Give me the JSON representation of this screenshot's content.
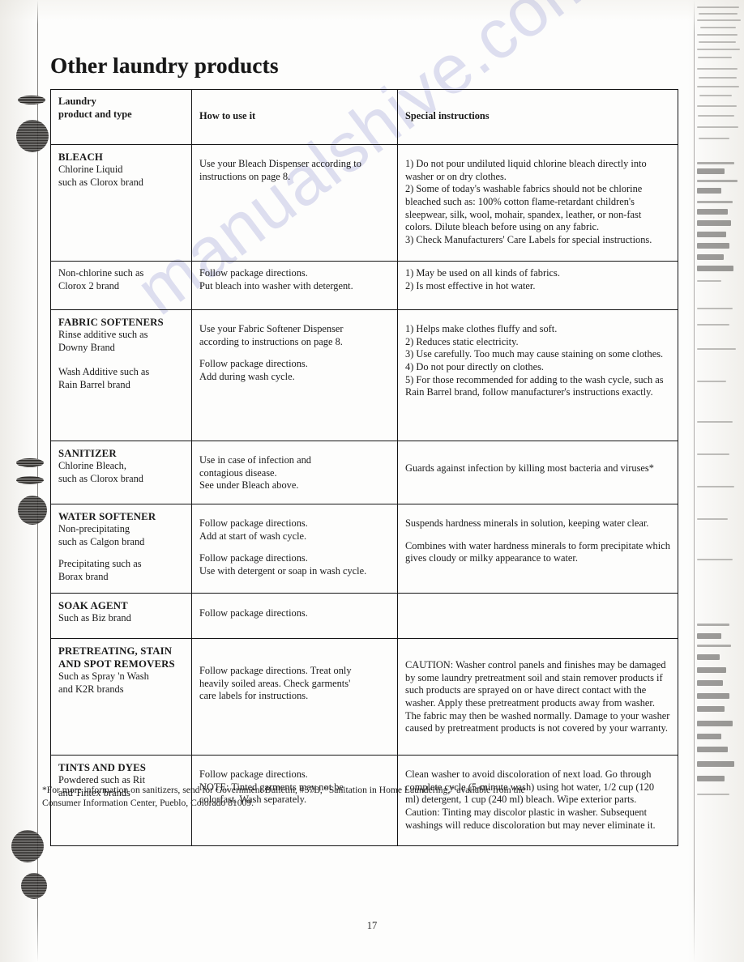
{
  "page": {
    "title": "Other laundry products",
    "number": "17",
    "watermark": "manualshive.com"
  },
  "table": {
    "headers": {
      "product": "Laundry\nproduct and type",
      "product_line1": "Laundry",
      "product_line2": "product and type",
      "how_to_use": "How to use it",
      "special": "Special instructions"
    },
    "rows": [
      {
        "id": "bleach",
        "product_title": "BLEACH",
        "product_sub": [
          "Chlorine Liquid",
          "such as Clorox brand"
        ],
        "how_to_use": [
          "Use your Bleach Dispenser according to",
          "instructions on page 8."
        ],
        "special": [
          "1) Do not pour undiluted liquid chlorine bleach directly into washer or on dry clothes.",
          "2) Some of today's washable fabrics should not be chlorine bleached such as: 100% cotton flame-retardant children's sleepwear, silk, wool, mohair, spandex, leather, or non-fast colors. Dilute bleach before using on any fabric.",
          "3) Check Manufacturers' Care Labels for special instructions."
        ]
      },
      {
        "id": "bleach-nonchlorine",
        "product_title": "",
        "product_sub": [
          "Non-chlorine such as",
          "Clorox 2 brand"
        ],
        "how_to_use": [
          "Follow package directions.",
          "Put bleach into washer with detergent."
        ],
        "special": [
          "1) May be used on all kinds of fabrics.",
          "2) Is most effective in hot water."
        ]
      },
      {
        "id": "fabric-softeners",
        "product_title": "FABRIC SOFTENERS",
        "product_sub": [
          "Rinse additive such as",
          "Downy Brand"
        ],
        "product_sub2": [
          "Wash Additive such as",
          "Rain Barrel brand"
        ],
        "how_to_use": [
          "Use your Fabric Softener Dispenser",
          "according to instructions on page 8."
        ],
        "how_to_use2": [
          "Follow package directions.",
          "Add during wash cycle."
        ],
        "special": [
          "1) Helps make clothes fluffy and soft.",
          "2) Reduces static electricity.",
          "3) Use carefully. Too much may cause staining on some clothes.",
          "4) Do not pour directly on clothes.",
          "5) For those recommended for adding to the wash cycle, such as Rain Barrel brand, follow manufacturer's instructions exactly."
        ]
      },
      {
        "id": "sanitizer",
        "product_title": "SANITIZER",
        "product_sub": [
          "Chlorine Bleach,",
          "such as Clorox brand"
        ],
        "how_to_use": [
          "Use in case of infection and",
          "contagious disease.",
          "See under Bleach above."
        ],
        "special_plain": "Guards against infection by killing most bacteria and viruses*"
      },
      {
        "id": "water-softener",
        "product_title": "WATER SOFTENER",
        "product_sub": [
          "Non-precipitating",
          "such as Calgon brand"
        ],
        "product_sub2": [
          "Precipitating such as",
          "Borax brand"
        ],
        "how_to_use": [
          "Follow package directions.",
          "Add at start of wash cycle."
        ],
        "how_to_use2": [
          "Follow package directions.",
          "Use with detergent or soap in wash cycle."
        ],
        "special_plain": "Suspends hardness minerals in solution, keeping water clear.",
        "special_plain2": "Combines with water hardness minerals to form precipitate which gives cloudy or milky appearance to water."
      },
      {
        "id": "soak-agent",
        "product_title": "SOAK AGENT",
        "product_sub": [
          "Such as Biz brand"
        ],
        "how_to_use": [
          "Follow package directions."
        ],
        "special_plain": ""
      },
      {
        "id": "pretreating",
        "product_title_line1": "PRETREATING, STAIN",
        "product_title_line2": "AND SPOT REMOVERS",
        "product_sub": [
          "Such as Spray 'n Wash",
          "and K2R brands"
        ],
        "how_to_use": [
          "Follow package directions. Treat only",
          "heavily soiled areas. Check garments'",
          "care labels for instructions."
        ],
        "special_plain": "CAUTION: Washer control panels and finishes may be damaged by some laundry pretreatment soil and stain remover products if such products are sprayed on or have direct contact with the washer. Apply these pretreatment products away from washer. The fabric may then be washed normally. Damage to your washer caused by pretreatment products is not covered by your warranty."
      },
      {
        "id": "tints-and-dyes",
        "product_title": "TINTS AND DYES",
        "product_sub": [
          "Powdered such as Rit",
          "and Tintex brands"
        ],
        "how_to_use": [
          "Follow package directions.",
          "NOTE: Tinted garments may not be",
          "colorfast. Wash separately."
        ],
        "special_plain": "Clean washer to avoid discoloration of next load. Go through complete cycle (5-minute wash) using hot water, 1/2 cup (120 ml) detergent, 1 cup (240 ml) bleach. Wipe exterior parts. Caution: Tinting may discolor plastic in washer. Subsequent washings will reduce discoloration but may never eliminate it."
      }
    ]
  },
  "footnote": {
    "line1": "*For more information on sanitizers, send for Government Bulletin, #57B, “Sanitation in Home Laundering,” available from the",
    "line2": "Consumer Information Center, Pueblo, Colorado 81009."
  }
}
